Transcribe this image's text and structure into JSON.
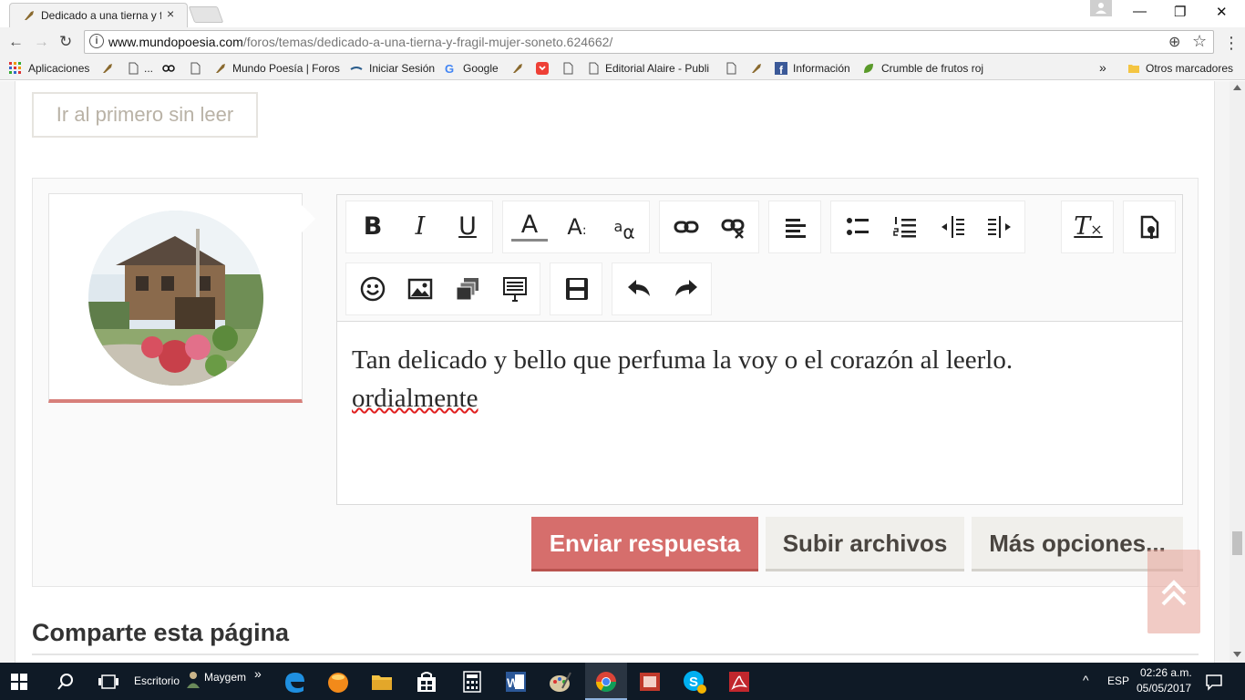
{
  "browser": {
    "tab_title": "Dedicado a una tierna y f",
    "close_glyph": "×",
    "window_controls": {
      "minimize": "—",
      "restore": "❐",
      "close": "✕"
    },
    "url_host": "www.mundopoesia.com",
    "url_path": "/foros/temas/dedicado-a-una-tierna-y-fragil-mujer-soneto.624662/",
    "nav": {
      "back": "←",
      "forward": "→",
      "reload": "↻",
      "zoom": "⊕",
      "star": "☆",
      "menu": "⋮",
      "info": "i"
    }
  },
  "bookmarks": {
    "apps": "Aplicaciones",
    "ellipsis": "...",
    "mundo": "Mundo Poesía | Foros",
    "login": "Iniciar Sesión",
    "google": "Google",
    "alaire": "Editorial Alaire - Publi",
    "info": "Información",
    "crumble": "Crumble de frutos roj",
    "overflow": "»",
    "other": "Otros marcadores"
  },
  "page": {
    "first_unread": "Ir al primero sin leer",
    "editor_text_line1": "Tan delicado y bello que perfuma la voy o el corazón al leerlo.",
    "editor_text_line2": "ordialmente",
    "send": "Enviar respuesta",
    "upload": "Subir archivos",
    "more": "Más opciones...",
    "share_title": "Comparte esta página",
    "toolbar": {
      "bold": "B",
      "italic": "I",
      "underline": "U",
      "font_color": "A",
      "font_size": "A",
      "font_size_mark": ":",
      "smallcaps_a": "a",
      "smallcaps_alpha": "α",
      "clear_format": "T",
      "clear_format_x": "×"
    }
  },
  "taskbar": {
    "desktop": "Escritorio",
    "user": "Maygem",
    "expand": "»",
    "lang": "ESP",
    "time": "02:26 a.m.",
    "date": "05/05/2017",
    "tray_arrow": "^"
  },
  "colors": {
    "accent": "#d66e6c",
    "muted_button": "#f0efeb",
    "taskbar": "#0f1a26"
  }
}
